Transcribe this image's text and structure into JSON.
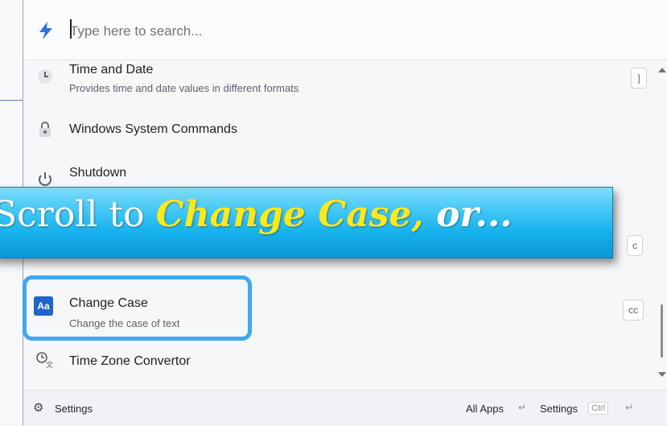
{
  "search": {
    "placeholder": "Type here to search..."
  },
  "results": [
    {
      "title": "Time and Date",
      "subtitle": "Provides time and date values in different formats",
      "icon": "clock-icon",
      "shortcut": "]"
    },
    {
      "title": "Windows System Commands",
      "subtitle": "",
      "icon": "lock-icon",
      "shortcut": ""
    },
    {
      "title": "Shutdown",
      "subtitle": "",
      "icon": "power-icon",
      "shortcut": ""
    },
    {
      "title": "",
      "subtitle": "",
      "icon": "",
      "shortcut": "c"
    },
    {
      "title": "Change Case",
      "subtitle": "Change the case of text",
      "icon": "change-case-icon",
      "shortcut": "cc",
      "icon_text": "Aa"
    },
    {
      "title": "Time Zone Convertor",
      "subtitle": "",
      "icon": "time-zone-icon",
      "shortcut": ""
    }
  ],
  "footer": {
    "settings_label": "Settings",
    "all_apps_label": "All Apps",
    "enter_symbol": "↵",
    "settings2_label": "Settings",
    "ctrl_label": "Ctrl"
  },
  "banner": {
    "prefix": "Scroll to ",
    "emphasis": "Change Case,",
    "suffix": " or..."
  },
  "colors": {
    "banner_bg": "#15b0ec",
    "banner_emphasis": "#ffe81a",
    "highlight_border": "#3ea8f0",
    "search_icon": "#2f6fe0"
  }
}
